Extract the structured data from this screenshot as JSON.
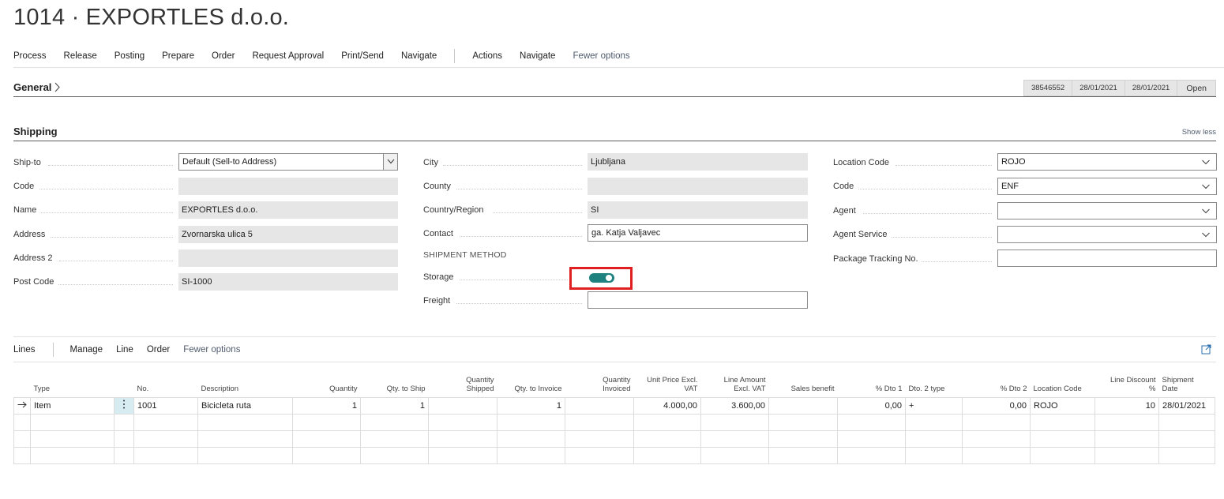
{
  "page": {
    "title": "1014 · EXPORTLES d.o.o."
  },
  "action_bar": {
    "items": [
      "Process",
      "Release",
      "Posting",
      "Prepare",
      "Order",
      "Request Approval",
      "Print/Send",
      "Navigate"
    ],
    "items2": [
      "Actions",
      "Navigate"
    ],
    "fewer_options": "Fewer options"
  },
  "general": {
    "title": "General",
    "badges": [
      "38546552",
      "28/01/2021",
      "28/01/2021",
      "Open"
    ]
  },
  "shipping": {
    "title": "Shipping",
    "show_less": "Show less",
    "col1": {
      "ship_to_label": "Ship-to",
      "ship_to_value": "Default (Sell-to Address)",
      "code_label": "Code",
      "code_value": "",
      "name_label": "Name",
      "name_value": "EXPORTLES d.o.o.",
      "address_label": "Address",
      "address_value": "Zvornarska ulica 5",
      "address2_label": "Address 2",
      "address2_value": "",
      "post_code_label": "Post Code",
      "post_code_value": "SI-1000"
    },
    "col2": {
      "city_label": "City",
      "city_value": "Ljubljana",
      "county_label": "County",
      "county_value": "",
      "country_label": "Country/Region",
      "country_value": "SI",
      "contact_label": "Contact",
      "contact_value": "ga. Katja Valjavec",
      "shipment_method_label": "SHIPMENT METHOD",
      "storage_label": "Storage",
      "storage_on": true,
      "freight_label": "Freight",
      "freight_value": ""
    },
    "col3": {
      "location_code_label": "Location Code",
      "location_code_value": "ROJO",
      "code_label": "Code",
      "code_value": "ENF",
      "agent_label": "Agent",
      "agent_value": "",
      "agent_service_label": "Agent Service",
      "agent_service_value": "",
      "package_tracking_label": "Package Tracking No.",
      "package_tracking_value": ""
    }
  },
  "lines": {
    "tabs": [
      "Lines"
    ],
    "actions": [
      "Manage",
      "Line",
      "Order"
    ],
    "fewer_options": "Fewer options",
    "headers": {
      "type": "Type",
      "no": "No.",
      "description": "Description",
      "quantity": "Quantity",
      "qty_to_ship": "Qty. to Ship",
      "qty_shipped_1": "Quantity",
      "qty_shipped_2": "Shipped",
      "qty_to_invoice": "Qty. to Invoice",
      "qty_invoiced_1": "Quantity",
      "qty_invoiced_2": "Invoiced",
      "unit_price_1": "Unit Price Excl.",
      "unit_price_2": "VAT",
      "line_amount_1": "Line Amount",
      "line_amount_2": "Excl. VAT",
      "sales_benefit": "Sales benefit",
      "dto1": "% Dto 1",
      "dto2_type": "Dto. 2 type",
      "dto2": "% Dto 2",
      "location_code": "Location Code",
      "line_discount_1": "Line Discount",
      "line_discount_2": "%",
      "shipment_date_1": "Shipment",
      "shipment_date_2": "Date"
    },
    "rows": [
      {
        "type": "Item",
        "no": "1001",
        "description": "Bicicleta ruta",
        "quantity": "1",
        "qty_to_ship": "1",
        "qty_shipped": "",
        "qty_to_invoice": "1",
        "qty_invoiced": "",
        "unit_price": "4.000,00",
        "line_amount": "3.600,00",
        "sales_benefit": "",
        "dto1": "0,00",
        "dto2_type": "+",
        "dto2": "0,00",
        "location_code": "ROJO",
        "line_discount": "10",
        "shipment_date": "28/01/2021"
      }
    ]
  },
  "colors": {
    "toggle_on": "#1f8080",
    "highlight": "#e02020"
  }
}
